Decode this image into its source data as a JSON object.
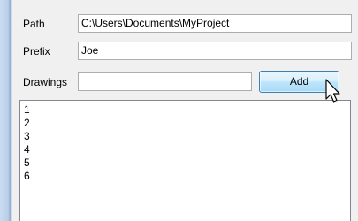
{
  "form": {
    "path_label": "Path",
    "path_value": "C:\\Users\\Documents\\MyProject",
    "prefix_label": "Prefix",
    "prefix_value": "Joe",
    "drawings_label": "Drawings",
    "drawings_value": "",
    "add_label": "Add"
  },
  "list": {
    "items": [
      "1",
      "2",
      "3",
      "4",
      "5",
      "6"
    ]
  },
  "colors": {
    "accent_button": "#bee6fd",
    "panel_background": "#f0f0f0",
    "window_frame": "#b9cfe9"
  },
  "icons": {
    "cursor": "arrow-cursor-icon"
  }
}
